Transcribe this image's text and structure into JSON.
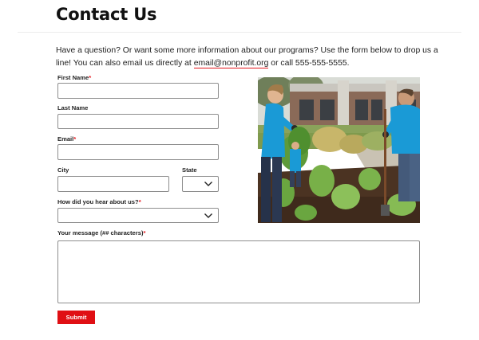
{
  "page": {
    "title": "Contact Us",
    "intro_text": "Have a question? Or want some more information about our programs? Use the form below to drop us a line! You can also email us directly at ",
    "email_link": "email@nonprofit.org",
    "intro_suffix": " or call 555-555-5555."
  },
  "form": {
    "required_marker": "*",
    "first_name": {
      "label": "First Name",
      "required": true,
      "value": "",
      "placeholder": ""
    },
    "last_name": {
      "label": "Last Name",
      "required": false,
      "value": "",
      "placeholder": ""
    },
    "email": {
      "label": "Email",
      "required": true,
      "value": "",
      "placeholder": ""
    },
    "city": {
      "label": "City",
      "required": false,
      "value": "",
      "placeholder": ""
    },
    "state": {
      "label": "State",
      "required": false,
      "selected": ""
    },
    "heard_about": {
      "label": "How did you hear about us?",
      "required": true,
      "selected": ""
    },
    "message": {
      "label": "Your message (## characters)",
      "required": true,
      "value": "",
      "placeholder": ""
    },
    "submit_label": "Submit"
  },
  "image": {
    "subject": "Volunteers in blue shirts planting in a garden bed"
  },
  "colors": {
    "accent": "#e00f14",
    "text": "#111111",
    "border": "#8e8e8e",
    "volunteer_shirt": "#1a9ad6"
  },
  "icons": {
    "select_arrow": "chevron-down-icon"
  }
}
